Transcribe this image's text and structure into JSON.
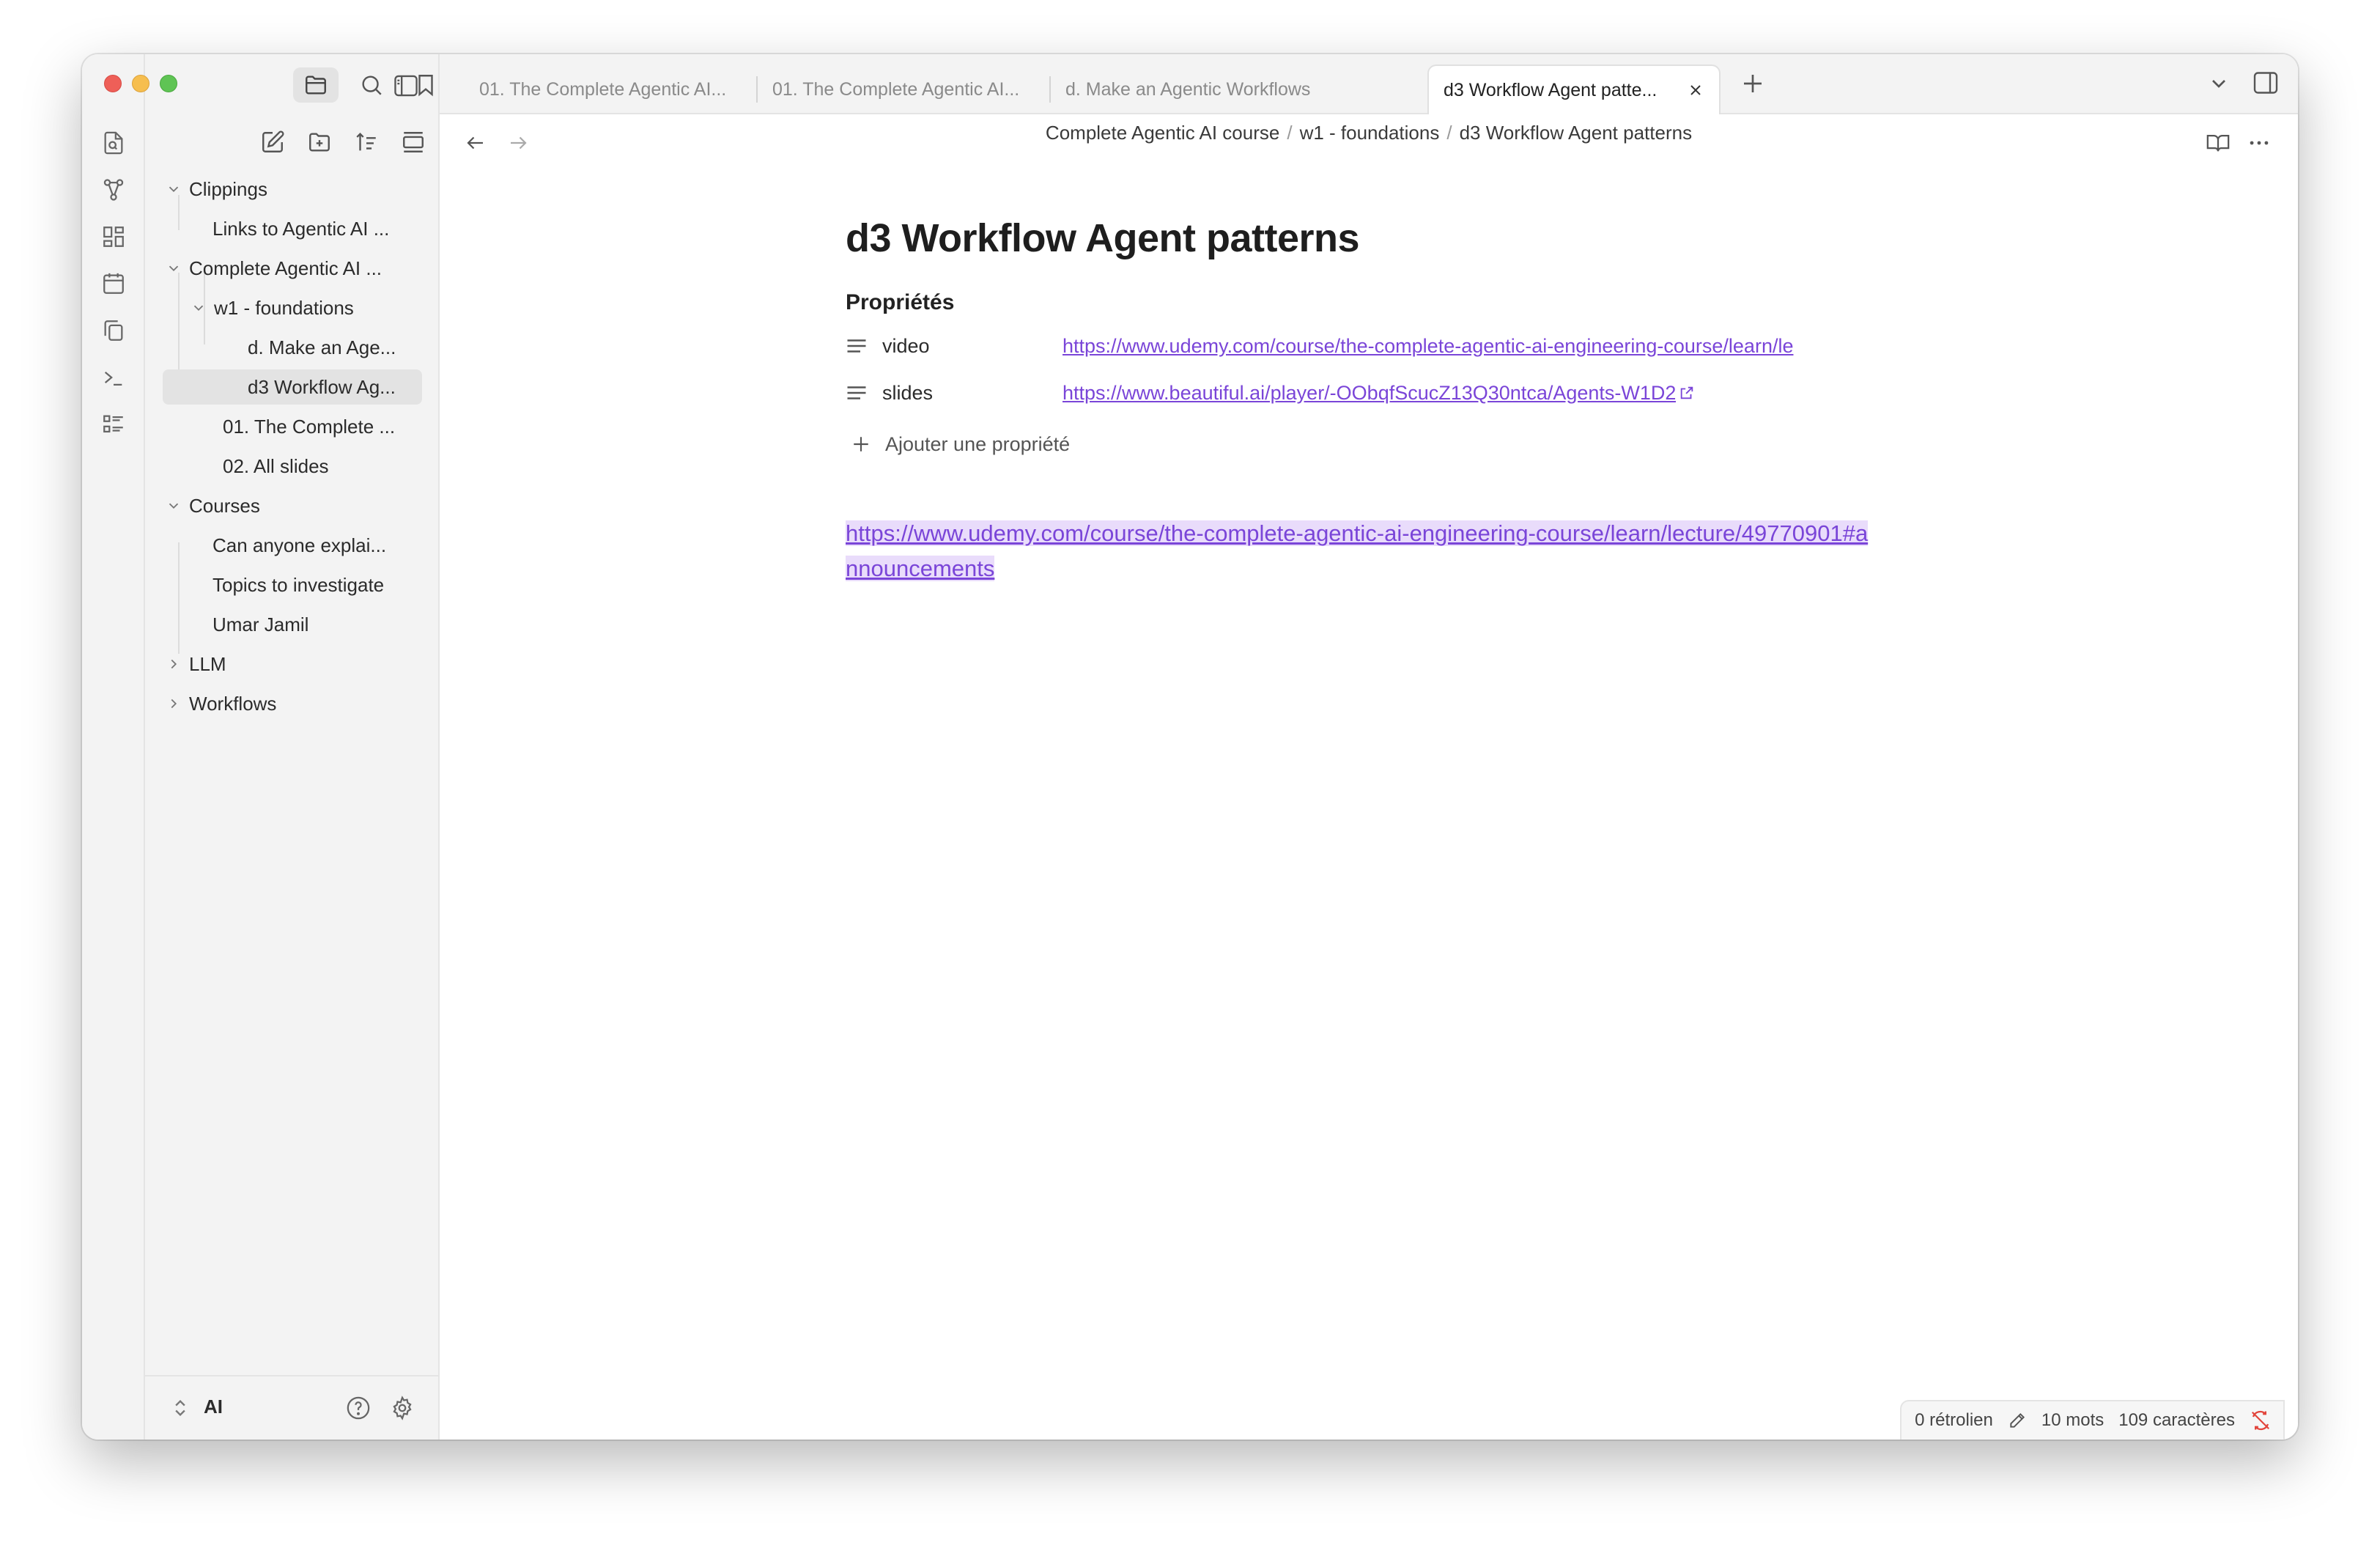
{
  "tabs": [
    {
      "label": "01. The Complete Agentic AI..."
    },
    {
      "label": "01. The Complete Agentic AI..."
    },
    {
      "label": "d. Make an Agentic Workflows"
    },
    {
      "label": "d3 Workflow Agent patte..."
    }
  ],
  "breadcrumb": {
    "part1": "Complete Agentic AI course",
    "part2": "w1 - foundations",
    "part3": "d3 Workflow Agent patterns",
    "separator": "/"
  },
  "sidebar": {
    "tree": [
      {
        "label": "Clippings"
      },
      {
        "label": "Links to Agentic AI ..."
      },
      {
        "label": "Complete Agentic AI ..."
      },
      {
        "label": "w1 - foundations"
      },
      {
        "label": "d. Make an Age..."
      },
      {
        "label": "d3 Workflow Ag..."
      },
      {
        "label": "01. The Complete ..."
      },
      {
        "label": "02. All slides"
      },
      {
        "label": "Courses"
      },
      {
        "label": "Can anyone explai..."
      },
      {
        "label": "Topics to investigate"
      },
      {
        "label": "Umar Jamil"
      },
      {
        "label": "LLM"
      },
      {
        "label": "Workflows"
      }
    ],
    "vault": "AI"
  },
  "note": {
    "title": "d3 Workflow Agent patterns",
    "properties_heading": "Propriétés",
    "properties": [
      {
        "key": "video",
        "value": "https://www.udemy.com/course/the-complete-agentic-ai-engineering-course/learn/le"
      },
      {
        "key": "slides",
        "value": "https://www.beautiful.ai/player/-OObqfScucZ13Q30ntca/Agents-W1D2"
      }
    ],
    "add_property": "Ajouter une propriété",
    "body_link": "https://www.udemy.com/course/the-complete-agentic-ai-engineering-course/learn/lecture/49770901#announcements"
  },
  "status": {
    "backlinks": "0 rétrolien",
    "words": "10 mots",
    "chars": "109 caractères"
  },
  "colors": {
    "accent": "#7a45d8",
    "link_highlight": "#e9dcfb",
    "sync_error": "#e2453c"
  },
  "icons": {
    "ribbon": [
      "file-search-icon",
      "graph-icon",
      "canvas-icon",
      "calendar-icon",
      "copy-icon",
      "terminal-icon",
      "list-icon"
    ],
    "sidebar_top": [
      "folder-icon",
      "search-icon",
      "bookmark-icon",
      "sidebar-toggle-icon"
    ],
    "nav_actions": [
      "new-note-icon",
      "new-folder-icon",
      "sort-icon",
      "collapse-all-icon",
      "close-icon"
    ]
  }
}
